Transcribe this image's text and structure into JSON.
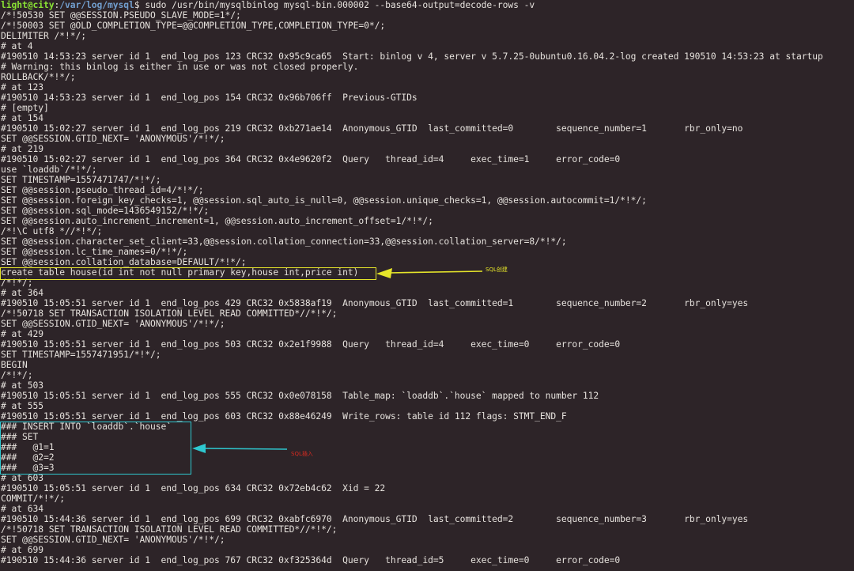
{
  "terminal": {
    "prompt": {
      "user_host": "light@city",
      "separator": ":",
      "path": "/var/log/mysql",
      "symbol": "$",
      "command": " sudo /usr/bin/mysqlbinlog mysql-bin.000002 --base64-output=decode-rows -v"
    },
    "lines": [
      "/*!50530 SET @@SESSION.PSEUDO_SLAVE_MODE=1*/;",
      "/*!50003 SET @OLD_COMPLETION_TYPE=@@COMPLETION_TYPE,COMPLETION_TYPE=0*/;",
      "DELIMITER /*!*/;",
      "# at 4",
      "#190510 14:53:23 server id 1  end_log_pos 123 CRC32 0x95c9ca65  Start: binlog v 4, server v 5.7.25-0ubuntu0.16.04.2-log created 190510 14:53:23 at startup",
      "# Warning: this binlog is either in use or was not closed properly.",
      "ROLLBACK/*!*/;",
      "# at 123",
      "#190510 14:53:23 server id 1  end_log_pos 154 CRC32 0x96b706ff  Previous-GTIDs",
      "# [empty]",
      "# at 154",
      "#190510 15:02:27 server id 1  end_log_pos 219 CRC32 0xb271ae14  Anonymous_GTID  last_committed=0        sequence_number=1       rbr_only=no",
      "SET @@SESSION.GTID_NEXT= 'ANONYMOUS'/*!*/;",
      "# at 219",
      "#190510 15:02:27 server id 1  end_log_pos 364 CRC32 0x4e9620f2  Query   thread_id=4     exec_time=1     error_code=0",
      "use `loaddb`/*!*/;",
      "SET TIMESTAMP=1557471747/*!*/;",
      "SET @@session.pseudo_thread_id=4/*!*/;",
      "SET @@session.foreign_key_checks=1, @@session.sql_auto_is_null=0, @@session.unique_checks=1, @@session.autocommit=1/*!*/;",
      "SET @@session.sql_mode=1436549152/*!*/;",
      "SET @@session.auto_increment_increment=1, @@session.auto_increment_offset=1/*!*/;",
      "/*!\\C utf8 *//*!*/;",
      "SET @@session.character_set_client=33,@@session.collation_connection=33,@@session.collation_server=8/*!*/;",
      "SET @@session.lc_time_names=0/*!*/;",
      "SET @@session.collation_database=DEFAULT/*!*/;",
      "create table house(id int not null primary key,house int,price int)",
      "/*!*/;",
      "# at 364",
      "#190510 15:05:51 server id 1  end_log_pos 429 CRC32 0x5838af19  Anonymous_GTID  last_committed=1        sequence_number=2       rbr_only=yes",
      "/*!50718 SET TRANSACTION ISOLATION LEVEL READ COMMITTED*//*!*/;",
      "SET @@SESSION.GTID_NEXT= 'ANONYMOUS'/*!*/;",
      "# at 429",
      "#190510 15:05:51 server id 1  end_log_pos 503 CRC32 0x2e1f9988  Query   thread_id=4     exec_time=0     error_code=0",
      "SET TIMESTAMP=1557471951/*!*/;",
      "BEGIN",
      "/*!*/;",
      "# at 503",
      "#190510 15:05:51 server id 1  end_log_pos 555 CRC32 0x0e078158  Table_map: `loaddb`.`house` mapped to number 112",
      "# at 555",
      "#190510 15:05:51 server id 1  end_log_pos 603 CRC32 0x88e46249  Write_rows: table id 112 flags: STMT_END_F",
      "### INSERT INTO `loaddb`.`house`",
      "### SET",
      "###   @1=1",
      "###   @2=2",
      "###   @3=3",
      "# at 603",
      "#190510 15:05:51 server id 1  end_log_pos 634 CRC32 0x72eb4c62  Xid = 22",
      "COMMIT/*!*/;",
      "# at 634",
      "#190510 15:44:36 server id 1  end_log_pos 699 CRC32 0xabfc6970  Anonymous_GTID  last_committed=2        sequence_number=3       rbr_only=yes",
      "/*!50718 SET TRANSACTION ISOLATION LEVEL READ COMMITTED*//*!*/;",
      "SET @@SESSION.GTID_NEXT= 'ANONYMOUS'/*!*/;",
      "# at 699",
      "#190510 15:44:36 server id 1  end_log_pos 767 CRC32 0xf325364d  Query   thread_id=5     exec_time=0     error_code=0"
    ]
  },
  "annotations": {
    "create_label": "SQL创建",
    "insert_label": "SQL插入",
    "colors": {
      "create_highlight": "#e5e52a",
      "insert_highlight": "#2ec8d0",
      "insert_label": "#d42a20"
    }
  }
}
